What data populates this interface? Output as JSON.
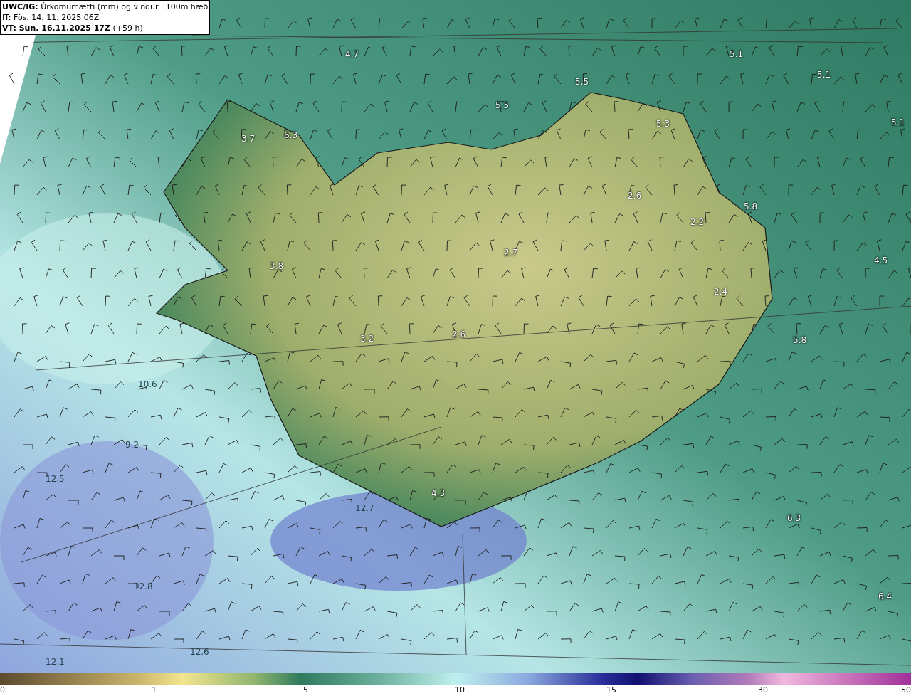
{
  "header": {
    "title": "**UWC/IG:** Úrkomumætti (mm) og vindur i 100m hæð",
    "issue_time": "IT: Fös. 14. 11. 2025 06Z",
    "valid_time": "**VT: Sun. 16.11.2025 17Z** (+59 h)"
  },
  "map": {
    "values": [
      "4.7",
      "5.1",
      "5.1",
      "5.5",
      "5.5",
      "5.3",
      "5.1",
      "3.7",
      "6.3",
      "2.6",
      "5.8",
      "2.2",
      "2.7",
      "3.8",
      "4.5",
      "2.4",
      "2.6",
      "3.2",
      "5.8",
      "10.6",
      "9.2",
      "12.5",
      "4.3",
      "12.7",
      "6.3",
      "12.8",
      "6.4",
      "12.6",
      "12.1"
    ]
  },
  "colorbar": {
    "ticks": [
      "0",
      "1",
      "5",
      "10",
      "15",
      "30",
      "50"
    ]
  }
}
